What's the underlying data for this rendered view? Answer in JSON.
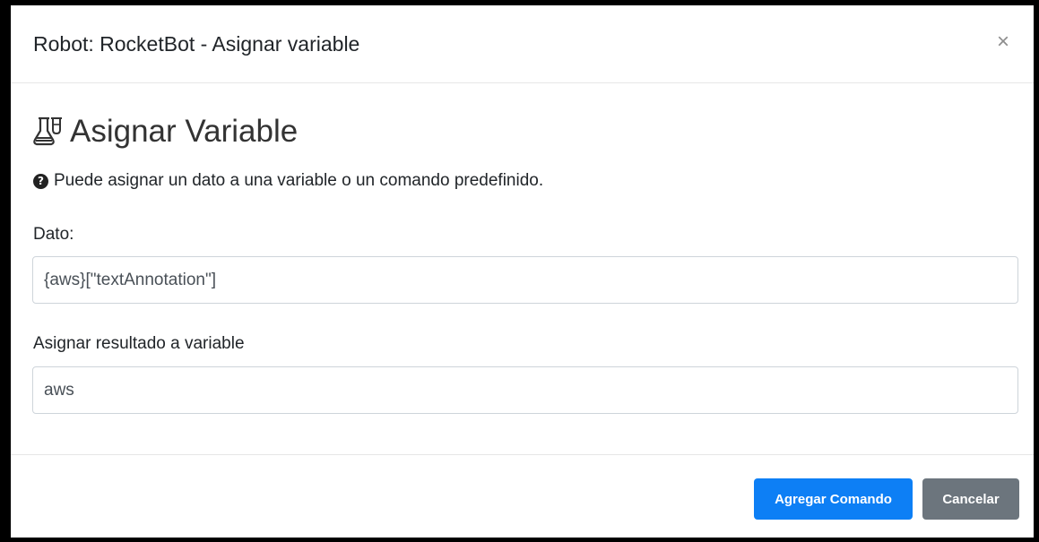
{
  "modal": {
    "title": "Robot: RocketBot - Asignar variable",
    "close_label": "×"
  },
  "body": {
    "heading": "Asignar Variable",
    "heading_icon": "flask-icon",
    "help_icon": "question-circle-icon",
    "help_text": "Puede asignar un dato a una variable o un comando predefinido.",
    "dato_label": "Dato:",
    "dato_value": "{aws}[\"textAnnotation\"]",
    "result_label": "Asignar resultado a variable",
    "result_value": "aws"
  },
  "footer": {
    "add_label": "Agregar Comando",
    "cancel_label": "Cancelar"
  },
  "colors": {
    "primary": "#0d7ff5",
    "secondary": "#6c757d",
    "backdrop": "#000000"
  }
}
